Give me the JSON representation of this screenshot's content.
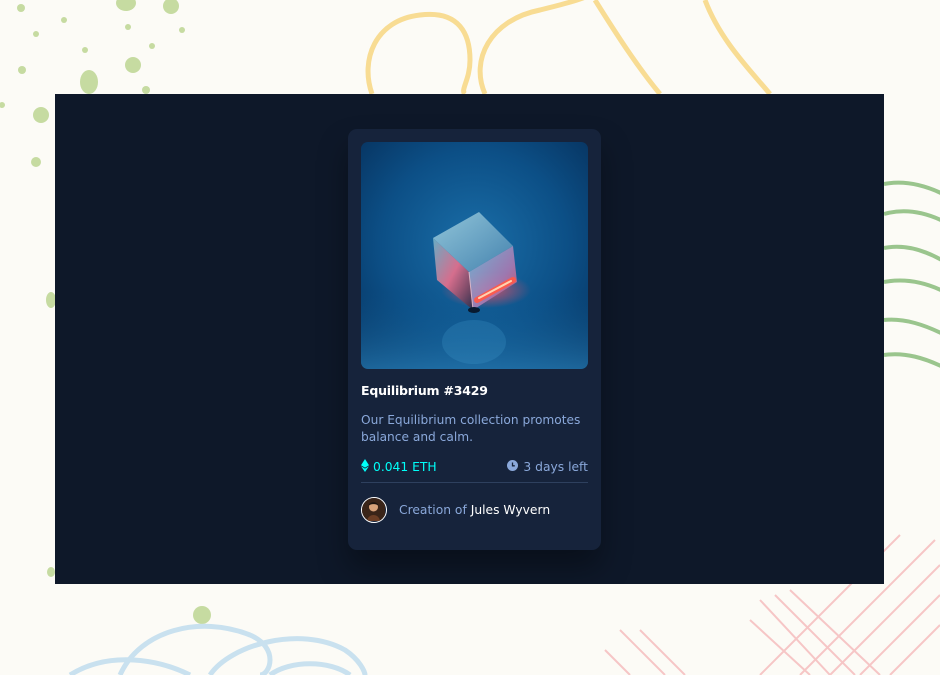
{
  "card": {
    "title": "Equilibrium #3429",
    "description": "Our Equilibrium collection promotes balance and calm.",
    "price": "0.041 ETH",
    "time_left": "3 days left",
    "creator_prefix": "Creation of",
    "creator_name": "Jules Wyvern"
  },
  "icons": {
    "price": "ethereum-icon",
    "time": "clock-icon",
    "art": "nft-cube-image",
    "avatar": "creator-avatar"
  },
  "colors": {
    "page_background": "#fcfbf6",
    "frame_background": "#0e1829",
    "card_background": "#16233b",
    "accent_cyan": "#00fff8",
    "muted_blue": "#8aa8da",
    "white": "#ffffff"
  }
}
